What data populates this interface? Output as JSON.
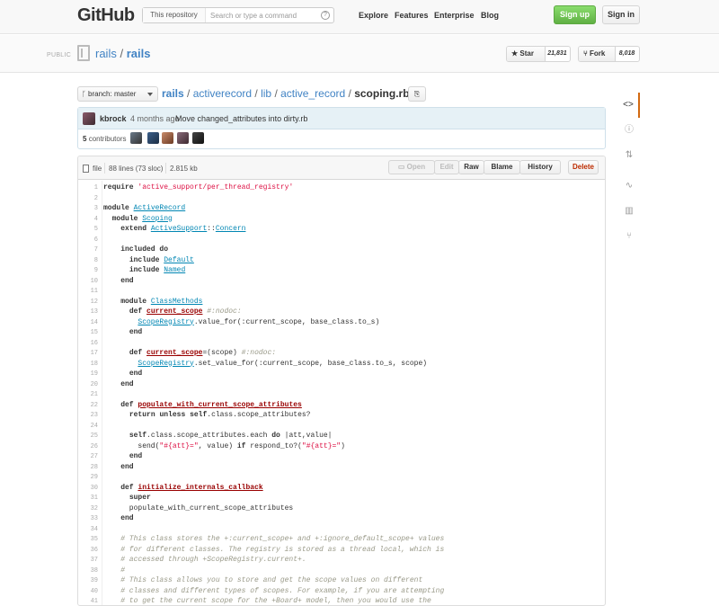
{
  "header": {
    "logo": "GitHub",
    "scope_label": "This repository",
    "search_placeholder": "Search or type a command",
    "help": "?",
    "nav": [
      "Explore",
      "Features",
      "Enterprise",
      "Blog"
    ],
    "signup": "Sign up",
    "signin": "Sign in"
  },
  "repo": {
    "visibility": "PUBLIC",
    "owner": "rails",
    "sep": " / ",
    "name": "rails",
    "star_label": "Star",
    "star_count": "21,831",
    "fork_label": "Fork",
    "fork_count": "8,018"
  },
  "breadcrumb": {
    "branch": "branch: master",
    "parts": [
      "rails",
      "activerecord",
      "lib",
      "active_record"
    ],
    "file": "scoping.rb"
  },
  "commit": {
    "author": "kbrock",
    "time": "4 months ago",
    "message": "Move changed_attributes into dirty.rb",
    "contributors_count": "5",
    "contributors_label": "contributors"
  },
  "file": {
    "type_label": "file",
    "lines": "88 lines (73 sloc)",
    "size": "2.815 kb",
    "buttons": [
      "Open",
      "Edit",
      "Raw",
      "Blame",
      "History",
      "Delete"
    ]
  },
  "colors": {
    "link": "#4183c4",
    "signup": "#60b044",
    "commit_bg": "#e6f1f6",
    "active_tab": "#d26911"
  },
  "sidebar_icons": [
    "code-icon",
    "issues-icon",
    "pull-request-icon",
    "pulse-icon",
    "graphs-icon",
    "network-icon"
  ],
  "code_lines": [
    "require 'active_support/per_thread_registry'",
    "",
    "module ActiveRecord",
    "  module Scoping",
    "    extend ActiveSupport::Concern",
    "",
    "    included do",
    "      include Default",
    "      include Named",
    "    end",
    "",
    "    module ClassMethods",
    "      def current_scope #:nodoc:",
    "        ScopeRegistry.value_for(:current_scope, base_class.to_s)",
    "      end",
    "",
    "      def current_scope=(scope) #:nodoc:",
    "        ScopeRegistry.set_value_for(:current_scope, base_class.to_s, scope)",
    "      end",
    "    end",
    "",
    "    def populate_with_current_scope_attributes",
    "      return unless self.class.scope_attributes?",
    "",
    "      self.class.scope_attributes.each do |att,value|",
    "        send(\"#{att}=\", value) if respond_to?(\"#{att}=\")",
    "      end",
    "    end",
    "",
    "    def initialize_internals_callback",
    "      super",
    "      populate_with_current_scope_attributes",
    "    end",
    "",
    "    # This class stores the +:current_scope+ and +:ignore_default_scope+ values",
    "    # for different classes. The registry is stored as a thread local, which is",
    "    # accessed through +ScopeRegistry.current+.",
    "    #",
    "    # This class allows you to store and get the scope values on different",
    "    # classes and different types of scopes. For example, if you are attempting",
    "    # to get the current scope for the +Board+ model, then you would use the"
  ]
}
